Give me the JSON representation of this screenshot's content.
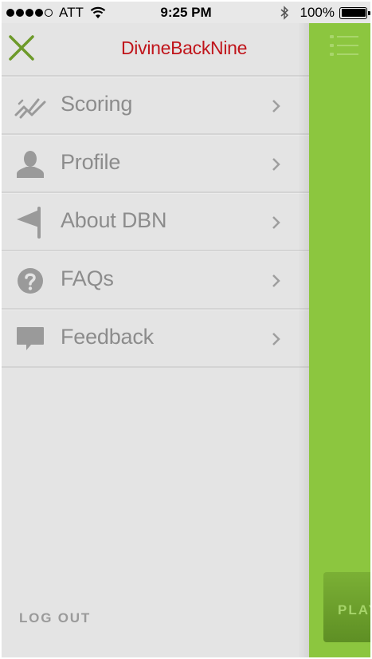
{
  "status_bar": {
    "carrier": "ATT",
    "time": "9:25 PM",
    "battery_percent": "100%",
    "signal_bars_filled": 4,
    "signal_bars_total": 5
  },
  "header": {
    "title": "DivineBackNine",
    "close_icon": "close-x-icon"
  },
  "menu": {
    "items": [
      {
        "label": "Scoring",
        "icon": "chart-line-icon"
      },
      {
        "label": "Profile",
        "icon": "person-icon"
      },
      {
        "label": "About DBN",
        "icon": "flag-icon"
      },
      {
        "label": "FAQs",
        "icon": "question-icon"
      },
      {
        "label": "Feedback",
        "icon": "speech-bubble-icon"
      }
    ]
  },
  "footer": {
    "logout_label": "LOG OUT"
  },
  "main_peek": {
    "play_label": "PLAY"
  },
  "colors": {
    "brand_red": "#c0151b",
    "accent_green": "#8cc63f",
    "drawer_bg": "#e4e4e4",
    "label_gray": "#8c8c8c"
  }
}
